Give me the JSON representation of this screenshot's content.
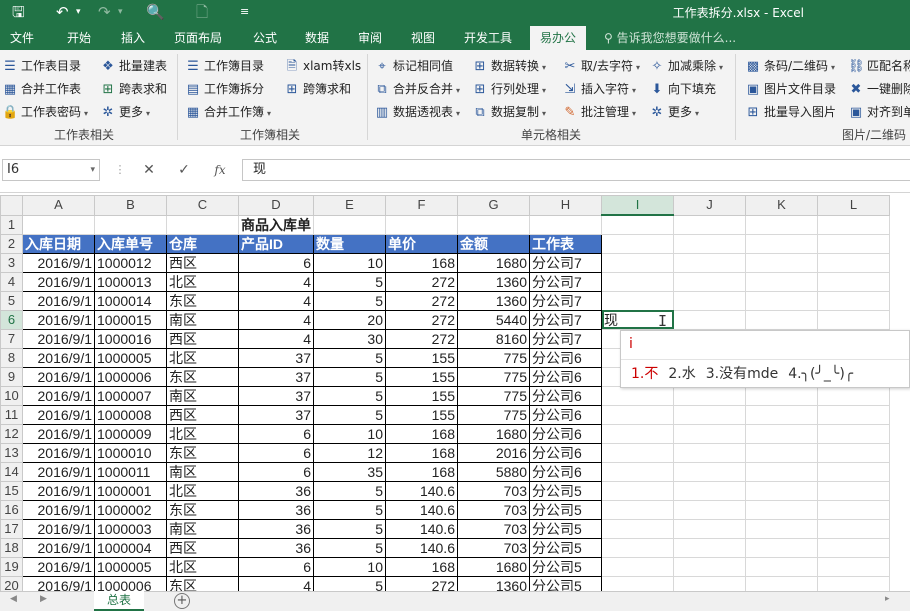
{
  "window": {
    "title": "工作表拆分.xlsx - Excel",
    "quick_access": [
      "save-icon",
      "undo-icon",
      "redo-icon",
      "print-preview-icon",
      "new-file-icon",
      "customize-icon"
    ]
  },
  "ribbon_tabs": [
    {
      "label": "文件",
      "active": false
    },
    {
      "label": "开始",
      "active": false
    },
    {
      "label": "插入",
      "active": false
    },
    {
      "label": "页面布局",
      "active": false
    },
    {
      "label": "公式",
      "active": false
    },
    {
      "label": "数据",
      "active": false
    },
    {
      "label": "审阅",
      "active": false
    },
    {
      "label": "视图",
      "active": false
    },
    {
      "label": "开发工具",
      "active": false
    },
    {
      "label": "易办公",
      "active": true
    }
  ],
  "tell_me": "告诉我您想要做什么...",
  "ribbon": {
    "groups": {
      "sheet": "工作表相关",
      "book": "工作簿相关",
      "cell": "单元格相关",
      "qr": "图片/二维码"
    },
    "buttons": {
      "sheet_dir": "工作表目录",
      "batch_create": "批量建表",
      "merge_sheet": "合并工作表",
      "cross_sum": "跨表求和",
      "sheet_pwd": "工作表密码",
      "more1": "更多",
      "book_dir": "工作簿目录",
      "xlam": "xlam转xls",
      "book_split": "工作簿拆分",
      "cross_book_sum": "跨簿求和",
      "merge_book": "合并工作簿",
      "mark_same": "标记相同值",
      "data_convert": "数据转换",
      "take_chars": "取/去字符",
      "add_sub": "加减乘除",
      "merge_unmerge": "合并反合并",
      "row_col": "行列处理",
      "insert_chars": "插入字符",
      "fill_down": "向下填充",
      "pivot": "数据透视表",
      "data_copy": "数据复制",
      "comment_mgr": "批注管理",
      "more2": "更多",
      "barcode": "条码/二维码",
      "match_name": "匹配名称",
      "img_dir": "图片文件目录",
      "one_delete": "一键删除",
      "batch_img": "批量导入图片",
      "align_to": "对齐到单"
    }
  },
  "formula_bar": {
    "name_box": "I6",
    "value": "现",
    "fx": "fx"
  },
  "sheet": {
    "col_headers": [
      "A",
      "B",
      "C",
      "D",
      "E",
      "F",
      "G",
      "H",
      "I",
      "J",
      "K",
      "L"
    ],
    "row_numbers": [
      "1",
      "2",
      "3",
      "4",
      "5",
      "6",
      "7",
      "8",
      "9",
      "10",
      "11",
      "12",
      "13",
      "14",
      "15",
      "16",
      "17",
      "18",
      "19",
      "20"
    ],
    "title": "商品入库单",
    "headers": [
      "入库日期",
      "入库单号",
      "仓库",
      "产品ID",
      "数量",
      "单价",
      "金额",
      "工作表"
    ],
    "rows": [
      [
        "2016/9/1",
        "1000012",
        "西区",
        "6",
        "10",
        "168",
        "1680",
        "分公司7"
      ],
      [
        "2016/9/1",
        "1000013",
        "北区",
        "4",
        "5",
        "272",
        "1360",
        "分公司7"
      ],
      [
        "2016/9/1",
        "1000014",
        "东区",
        "4",
        "5",
        "272",
        "1360",
        "分公司7"
      ],
      [
        "2016/9/1",
        "1000015",
        "南区",
        "4",
        "20",
        "272",
        "5440",
        "分公司7"
      ],
      [
        "2016/9/1",
        "1000016",
        "西区",
        "4",
        "30",
        "272",
        "8160",
        "分公司7"
      ],
      [
        "2016/9/1",
        "1000005",
        "北区",
        "37",
        "5",
        "155",
        "775",
        "分公司6"
      ],
      [
        "2016/9/1",
        "1000006",
        "东区",
        "37",
        "5",
        "155",
        "775",
        "分公司6"
      ],
      [
        "2016/9/1",
        "1000007",
        "南区",
        "37",
        "5",
        "155",
        "775",
        "分公司6"
      ],
      [
        "2016/9/1",
        "1000008",
        "西区",
        "37",
        "5",
        "155",
        "775",
        "分公司6"
      ],
      [
        "2016/9/1",
        "1000009",
        "北区",
        "6",
        "10",
        "168",
        "1680",
        "分公司6"
      ],
      [
        "2016/9/1",
        "1000010",
        "东区",
        "6",
        "12",
        "168",
        "2016",
        "分公司6"
      ],
      [
        "2016/9/1",
        "1000011",
        "南区",
        "6",
        "35",
        "168",
        "5880",
        "分公司6"
      ],
      [
        "2016/9/1",
        "1000001",
        "北区",
        "36",
        "5",
        "140.6",
        "703",
        "分公司5"
      ],
      [
        "2016/9/1",
        "1000002",
        "东区",
        "36",
        "5",
        "140.6",
        "703",
        "分公司5"
      ],
      [
        "2016/9/1",
        "1000003",
        "南区",
        "36",
        "5",
        "140.6",
        "703",
        "分公司5"
      ],
      [
        "2016/9/1",
        "1000004",
        "西区",
        "36",
        "5",
        "140.6",
        "703",
        "分公司5"
      ],
      [
        "2016/9/1",
        "1000005",
        "北区",
        "6",
        "10",
        "168",
        "1680",
        "分公司5"
      ],
      [
        "2016/9/1",
        "1000006",
        "东区",
        "4",
        "5",
        "272",
        "1360",
        "分公司5"
      ]
    ],
    "active_cell_value": "现"
  },
  "ime": {
    "composition": "i",
    "candidates": [
      "1.不",
      "2.水",
      "3.没有mde",
      "4.╮(╯_╰)╭"
    ]
  },
  "sheet_tabs": {
    "active": "总表",
    "add": "+"
  },
  "colors": {
    "excel_green": "#217346",
    "header_blue": "#4472c4"
  }
}
